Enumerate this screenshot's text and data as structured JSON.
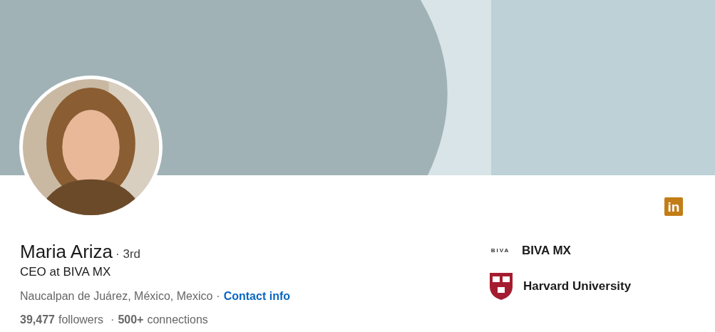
{
  "profile": {
    "name": "Maria Ariza",
    "degree": "· 3rd",
    "headline": "CEO at BIVA MX",
    "location": "Naucalpan de Juárez, México, Mexico",
    "separator": "·",
    "contact_link": "Contact info",
    "followers_count": "39,477",
    "followers_label": "followers",
    "connections_sep": "·",
    "connections_count": "500+",
    "connections_label": "connections"
  },
  "badge": {
    "text": "in"
  },
  "organizations": [
    {
      "kind": "biva",
      "logo_text": "BIVA",
      "name": "BIVA MX"
    },
    {
      "kind": "shield",
      "name": "Harvard University"
    }
  ]
}
